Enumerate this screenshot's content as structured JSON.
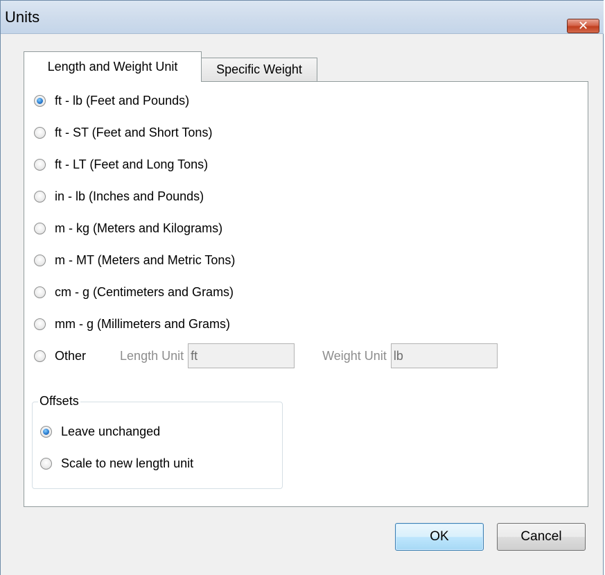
{
  "window": {
    "title": "Units",
    "close_glyph": "✕"
  },
  "tabs": [
    {
      "label": "Length and Weight Unit",
      "selected": true
    },
    {
      "label": "Specific Weight",
      "selected": false
    }
  ],
  "unit_options": [
    {
      "label": "ft - lb (Feet and Pounds)",
      "checked": true
    },
    {
      "label": "ft - ST (Feet and Short Tons)",
      "checked": false
    },
    {
      "label": "ft - LT (Feet and Long Tons)",
      "checked": false
    },
    {
      "label": "in - lb (Inches and Pounds)",
      "checked": false
    },
    {
      "label": "m - kg (Meters and Kilograms)",
      "checked": false
    },
    {
      "label": "m - MT (Meters and Metric Tons)",
      "checked": false
    },
    {
      "label": "cm - g (Centimeters and Grams)",
      "checked": false
    },
    {
      "label": "mm - g (Millimeters and Grams)",
      "checked": false
    }
  ],
  "other": {
    "label": "Other",
    "checked": false,
    "length_unit_label": "Length Unit",
    "length_unit_value": "ft",
    "weight_unit_label": "Weight Unit",
    "weight_unit_value": "lb"
  },
  "offsets": {
    "legend": "Offsets",
    "options": [
      {
        "label": "Leave unchanged",
        "checked": true
      },
      {
        "label": "Scale to new length unit",
        "checked": false
      }
    ]
  },
  "buttons": {
    "ok": "OK",
    "cancel": "Cancel"
  }
}
